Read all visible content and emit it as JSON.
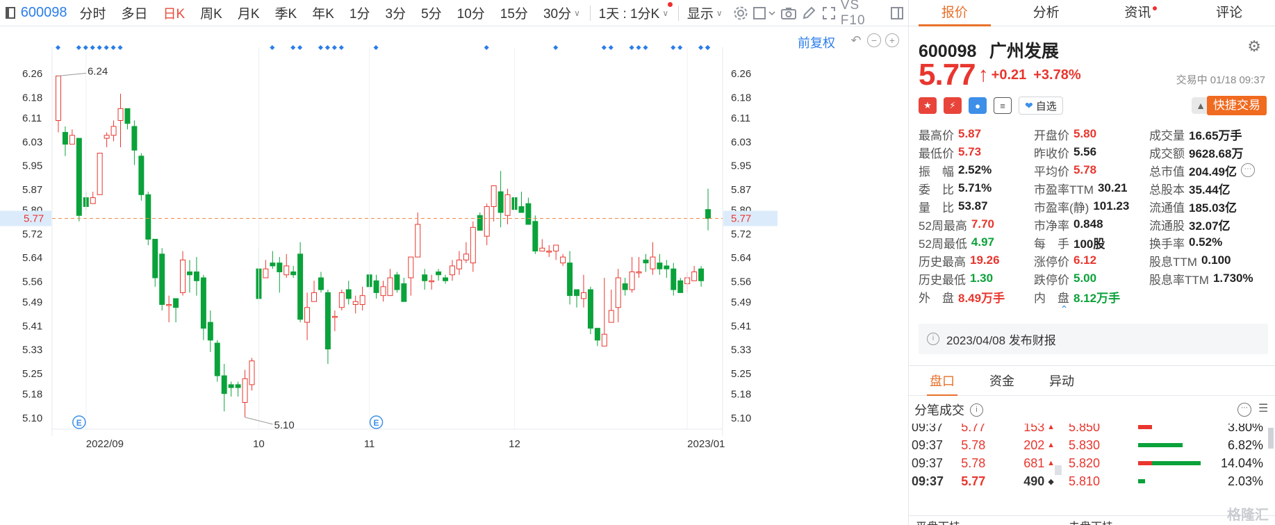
{
  "toolbar": {
    "code": "600098",
    "periods": [
      "分时",
      "多日",
      "日K",
      "周K",
      "月K",
      "季K",
      "年K",
      "1分",
      "3分",
      "5分",
      "10分",
      "15分"
    ],
    "active_period": "日K",
    "dropdown_30": "30分",
    "dropdown_multi": "1天 : 1分K",
    "display": "显示",
    "vs_f10": "VS F10"
  },
  "chart": {
    "adjust_label": "前复权",
    "current_price_label": "5.77",
    "max_label": "6.24",
    "min_label": "5.10",
    "event_marker": "E"
  },
  "chart_data": {
    "type": "candlestick",
    "y_ticks": [
      "6.26",
      "6.18",
      "6.11",
      "6.03",
      "5.95",
      "5.87",
      "5.80",
      "5.72",
      "5.64",
      "5.56",
      "5.49",
      "5.41",
      "5.33",
      "5.25",
      "5.18",
      "5.10"
    ],
    "ylim": [
      5.06,
      6.3
    ],
    "x_labels": [
      "2022/09",
      "10",
      "11",
      "12",
      "2023/01"
    ],
    "last_price": 5.77,
    "candles": [
      [
        6.1,
        6.25,
        6.06,
        6.24
      ],
      [
        6.06,
        6.02,
        5.98,
        6.08
      ],
      [
        6.02,
        6.05,
        6.03,
        6.07
      ],
      [
        6.04,
        5.78,
        5.76,
        5.99
      ],
      [
        5.84,
        5.81,
        5.8,
        5.86
      ],
      [
        5.82,
        5.84,
        5.82,
        5.86
      ],
      [
        5.85,
        5.99,
        5.86,
        5.96
      ],
      [
        6.04,
        6.05,
        6.01,
        6.06
      ],
      [
        6.05,
        6.08,
        6.03,
        6.1
      ],
      [
        6.1,
        6.14,
        6.01,
        6.19
      ],
      [
        6.14,
        6.09,
        6.07,
        6.13
      ],
      [
        6.08,
        6.0,
        5.95,
        6.1
      ],
      [
        5.98,
        5.85,
        5.83,
        5.99
      ],
      [
        5.85,
        5.7,
        5.68,
        5.86
      ],
      [
        5.7,
        5.57,
        5.54,
        5.7
      ],
      [
        5.65,
        5.48,
        5.46,
        5.67
      ],
      [
        5.48,
        5.48,
        5.42,
        5.51
      ],
      [
        5.5,
        5.47,
        5.42,
        5.5
      ],
      [
        5.52,
        5.63,
        5.51,
        5.66
      ],
      [
        5.59,
        5.58,
        5.52,
        5.63
      ],
      [
        5.59,
        5.56,
        5.51,
        5.64
      ],
      [
        5.57,
        5.4,
        5.36,
        5.58
      ],
      [
        5.42,
        5.36,
        5.32,
        5.46
      ],
      [
        5.35,
        5.24,
        5.22,
        5.36
      ],
      [
        5.24,
        5.18,
        5.12,
        5.28
      ],
      [
        5.21,
        5.2,
        5.17,
        5.22
      ],
      [
        5.21,
        5.2,
        5.17,
        5.22
      ],
      [
        5.15,
        5.23,
        5.1,
        5.26
      ],
      [
        5.21,
        5.29,
        5.19,
        5.3
      ],
      [
        5.6,
        5.5,
        5.48,
        5.67
      ],
      [
        5.57,
        5.6,
        5.57,
        5.63
      ],
      [
        5.62,
        5.61,
        5.6,
        5.66
      ],
      [
        5.62,
        5.59,
        5.52,
        5.64
      ],
      [
        5.58,
        5.61,
        5.57,
        5.65
      ],
      [
        5.59,
        5.58,
        5.57,
        5.61
      ],
      [
        5.65,
        5.43,
        5.42,
        5.69
      ],
      [
        5.42,
        5.47,
        5.36,
        5.52
      ],
      [
        5.49,
        5.52,
        5.5,
        5.56
      ],
      [
        5.57,
        5.53,
        5.52,
        5.59
      ],
      [
        5.52,
        5.33,
        5.28,
        5.53
      ],
      [
        5.44,
        5.44,
        5.39,
        5.46
      ],
      [
        5.47,
        5.52,
        5.46,
        5.53
      ],
      [
        5.53,
        5.5,
        5.48,
        5.56
      ],
      [
        5.48,
        5.49,
        5.45,
        5.51
      ],
      [
        5.48,
        5.51,
        5.46,
        5.54
      ],
      [
        5.58,
        5.54,
        5.53,
        5.59
      ],
      [
        5.56,
        5.52,
        5.5,
        5.58
      ],
      [
        5.51,
        5.54,
        5.49,
        5.56
      ],
      [
        5.51,
        5.57,
        5.51,
        5.6
      ],
      [
        5.58,
        5.53,
        5.52,
        5.59
      ],
      [
        5.55,
        5.49,
        5.49,
        5.57
      ],
      [
        5.57,
        5.64,
        5.51,
        5.61
      ],
      [
        5.64,
        5.75,
        5.69,
        5.79
      ],
      [
        5.58,
        5.56,
        5.53,
        5.6
      ],
      [
        5.56,
        5.56,
        5.53,
        5.58
      ],
      [
        5.59,
        5.58,
        5.56,
        5.6
      ],
      [
        5.57,
        5.56,
        5.55,
        5.58
      ],
      [
        5.58,
        5.61,
        5.56,
        5.63
      ],
      [
        5.6,
        5.63,
        5.58,
        5.66
      ],
      [
        5.63,
        5.65,
        5.62,
        5.69
      ],
      [
        5.62,
        5.74,
        5.59,
        5.76
      ],
      [
        5.78,
        5.73,
        5.73,
        5.79
      ],
      [
        5.71,
        5.81,
        5.68,
        5.82
      ],
      [
        5.81,
        5.88,
        5.76,
        5.88
      ],
      [
        5.86,
        5.79,
        5.74,
        5.93
      ],
      [
        5.78,
        5.85,
        5.75,
        5.87
      ],
      [
        5.84,
        5.8,
        5.79,
        5.92
      ],
      [
        5.81,
        5.79,
        5.79,
        5.86
      ],
      [
        5.82,
        5.75,
        5.76,
        5.84
      ],
      [
        5.76,
        5.66,
        5.65,
        5.78
      ],
      [
        5.66,
        5.67,
        5.66,
        5.7
      ],
      [
        5.66,
        5.66,
        5.64,
        5.68
      ],
      [
        5.66,
        5.68,
        5.63,
        5.68
      ],
      [
        5.62,
        5.64,
        5.61,
        5.65
      ],
      [
        5.62,
        5.51,
        5.48,
        5.66
      ],
      [
        5.53,
        5.51,
        5.47,
        5.53
      ],
      [
        5.5,
        5.52,
        5.47,
        5.58
      ],
      [
        5.53,
        5.4,
        5.38,
        5.54
      ],
      [
        5.4,
        5.36,
        5.34,
        5.4
      ],
      [
        5.34,
        5.38,
        5.34,
        5.57
      ],
      [
        5.42,
        5.46,
        5.42,
        5.53
      ],
      [
        5.47,
        5.57,
        5.42,
        5.6
      ],
      [
        5.55,
        5.53,
        5.51,
        5.57
      ],
      [
        5.53,
        5.59,
        5.52,
        5.64
      ],
      [
        5.59,
        5.59,
        5.57,
        5.64
      ],
      [
        5.63,
        5.62,
        5.59,
        5.65
      ],
      [
        5.6,
        5.64,
        5.58,
        5.69
      ],
      [
        5.62,
        5.6,
        5.58,
        5.65
      ],
      [
        5.61,
        5.6,
        5.57,
        5.63
      ],
      [
        5.6,
        5.53,
        5.51,
        5.62
      ],
      [
        5.56,
        5.52,
        5.53,
        5.57
      ],
      [
        5.55,
        5.57,
        5.52,
        5.59
      ],
      [
        5.56,
        5.59,
        5.57,
        5.61
      ],
      [
        5.6,
        5.56,
        5.54,
        5.61
      ],
      [
        5.8,
        5.77,
        5.73,
        5.87
      ]
    ],
    "event_positions": [
      3,
      46
    ]
  },
  "right": {
    "tabs": [
      "报价",
      "分析",
      "资讯",
      "评论"
    ],
    "active_tab": "报价",
    "code": "600098",
    "name": "广州发展",
    "price": "5.77",
    "change": "+0.21",
    "change_pct": "+3.78%",
    "trade_status": "交易中 01/18 09:37",
    "zixuan": "自选",
    "quick_trade": "快捷交易",
    "quote_rows": [
      [
        [
          "最高价",
          "5.87",
          "red"
        ],
        [
          "开盘价",
          "5.80",
          "red"
        ],
        [
          "成交量",
          "16.65万手",
          "dark"
        ]
      ],
      [
        [
          "最低价",
          "5.73",
          "red"
        ],
        [
          "昨收价",
          "5.56",
          "dark"
        ],
        [
          "成交额",
          "9628.68万",
          "dark"
        ]
      ],
      [
        [
          "振　幅",
          "2.52%",
          "dark"
        ],
        [
          "平均价",
          "5.78",
          "red"
        ],
        [
          "总市值",
          "204.49亿",
          "dark"
        ]
      ],
      [
        [
          "委　比",
          "5.71%",
          "dark"
        ],
        [
          "市盈率TTM",
          "30.21",
          "dark"
        ],
        [
          "总股本",
          "35.44亿",
          "dark"
        ]
      ],
      [
        [
          "量　比",
          "53.87",
          "dark"
        ],
        [
          "市盈率(静)",
          "101.23",
          "dark"
        ],
        [
          "流通值",
          "185.03亿",
          "dark"
        ]
      ],
      [
        [
          "52周最高",
          "7.70",
          "red"
        ],
        [
          "市净率",
          "0.848",
          "dark"
        ],
        [
          "流通股",
          "32.07亿",
          "dark"
        ]
      ],
      [
        [
          "52周最低",
          "4.97",
          "green"
        ],
        [
          "每　手",
          "100股",
          "dark"
        ],
        [
          "换手率",
          "0.52%",
          "dark"
        ]
      ],
      [
        [
          "历史最高",
          "19.26",
          "red"
        ],
        [
          "涨停价",
          "6.12",
          "red"
        ],
        [
          "股息TTM",
          "0.100",
          "dark"
        ]
      ],
      [
        [
          "历史最低",
          "1.30",
          "green"
        ],
        [
          "跌停价",
          "5.00",
          "green"
        ],
        [
          "股息率TTM",
          "1.730%",
          "dark"
        ]
      ],
      [
        [
          "外　盘",
          "8.49万手",
          "red"
        ],
        [
          "内　盘",
          "8.12万手",
          "green"
        ],
        [
          "",
          "",
          "dark"
        ]
      ]
    ],
    "report": "2023/04/08  发布财报",
    "subtabs": [
      "盘口",
      "资金",
      "异动"
    ],
    "active_subtab": "盘口",
    "fenbi_title": "分笔成交",
    "trades": [
      {
        "t": "09:37",
        "p": "5.77",
        "v": "153",
        "d": "▲",
        "bold": false
      },
      {
        "t": "09:37",
        "p": "5.78",
        "v": "202",
        "d": "▲",
        "bold": false
      },
      {
        "t": "09:37",
        "p": "5.78",
        "v": "681",
        "d": "▲",
        "bold": false
      },
      {
        "t": "09:37",
        "p": "5.77",
        "v": "490",
        "d": "◆",
        "bold": true
      }
    ],
    "ladder": [
      {
        "price": "5.850",
        "pct": "3.80%",
        "fill": 0.2,
        "color": "#e8362e"
      },
      {
        "price": "5.830",
        "pct": "6.82%",
        "fill": 0.64,
        "color": "#0aa23a"
      },
      {
        "price": "5.820",
        "pct": "14.04%",
        "fill": 0.88,
        "color": "#e8362e",
        "fill2": 0.7,
        "color2": "#0aa23a"
      },
      {
        "price": "5.810",
        "pct": "2.03%",
        "fill": 0.1,
        "color": "#0aa23a"
      }
    ],
    "bottom_left": "平盘下挂",
    "bottom_right": "未盘下挂"
  },
  "watermark": "格隆汇",
  "colors": {
    "up": "#e8362e",
    "down": "#0aa23a",
    "accent": "#e8702a",
    "link": "#2b7de9"
  }
}
